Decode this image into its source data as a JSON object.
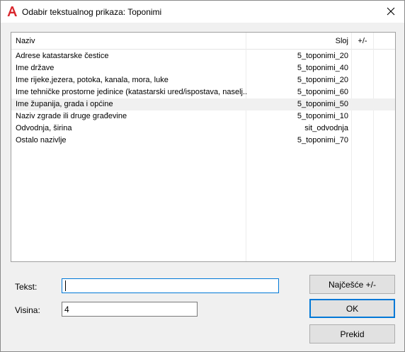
{
  "window": {
    "title": "Odabir tekstualnog prikaza: Toponimi",
    "close_symbol": "✕",
    "app_icon": "autocad-a-icon",
    "accent_color": "#0078d7",
    "icon_color": "#d9262c"
  },
  "table": {
    "headers": {
      "naziv": "Naziv",
      "sloj": "Sloj",
      "pm": "+/-"
    },
    "rows": [
      {
        "naziv": "Adrese katastarske čestice",
        "sloj": "5_toponimi_20",
        "pm": ""
      },
      {
        "naziv": "Ime države",
        "sloj": "5_toponimi_40",
        "pm": ""
      },
      {
        "naziv": "Ime rijeke,jezera, potoka, kanala, mora, luke",
        "sloj": "5_toponimi_20",
        "pm": ""
      },
      {
        "naziv": "Ime tehničke prostorne jedinice (katastarski ured/ispostava, naselj...",
        "sloj": "5_toponimi_60",
        "pm": ""
      },
      {
        "naziv": "Ime županija, grada i općine",
        "sloj": "5_toponimi_50",
        "pm": ""
      },
      {
        "naziv": "Naziv zgrade ili druge građevine",
        "sloj": "5_toponimi_10",
        "pm": ""
      },
      {
        "naziv": "Odvodnja, širina",
        "sloj": "sit_odvodnja",
        "pm": ""
      },
      {
        "naziv": "Ostalo nazivlje",
        "sloj": "5_toponimi_70",
        "pm": ""
      }
    ],
    "selected_index": 4
  },
  "form": {
    "tekst_label": "Tekst:",
    "tekst_value": "",
    "visina_label": "Visina:",
    "visina_value": "4"
  },
  "buttons": {
    "najcesce": "Najčešće +/-",
    "ok": "OK",
    "prekid": "Prekid"
  }
}
